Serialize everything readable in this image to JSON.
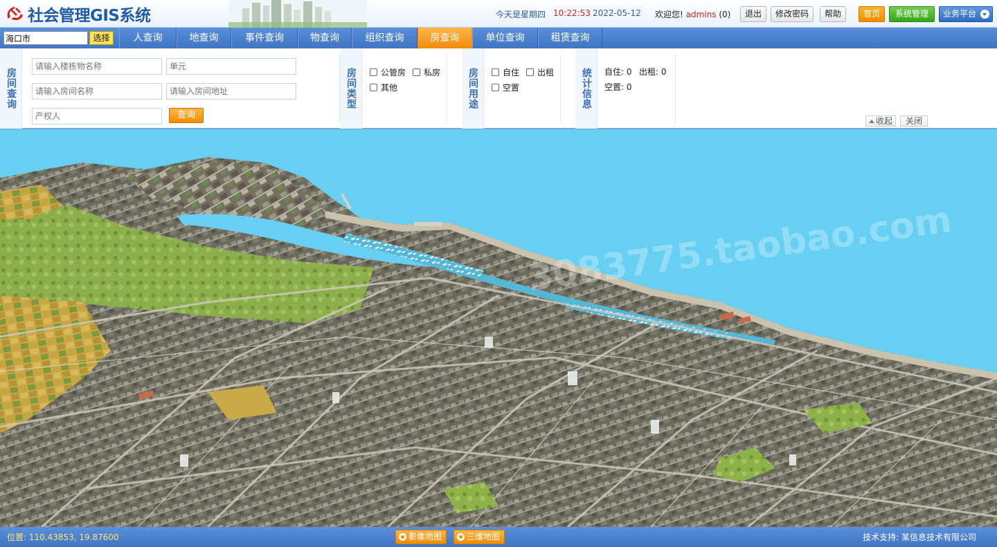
{
  "header": {
    "title": "社会管理GIS系统",
    "date_label": "今天是星期四",
    "clock": "10:22:53",
    "date": "2022-05-12",
    "welcome": "欢迎您!",
    "user": "admins",
    "user_count": "(0)",
    "logout": "退出",
    "change_password": "修改密码",
    "help": "帮助",
    "home": "首页",
    "system_admin": "系统管理",
    "business_platform": "业务平台"
  },
  "nav": {
    "city_value": "海口市",
    "city_button": "选择",
    "tabs": [
      {
        "label": "人查询",
        "active": false
      },
      {
        "label": "地查询",
        "active": false
      },
      {
        "label": "事件查询",
        "active": false
      },
      {
        "label": "物查询",
        "active": false
      },
      {
        "label": "组织查询",
        "active": false
      },
      {
        "label": "房查询",
        "active": true
      },
      {
        "label": "单位查询",
        "active": false
      },
      {
        "label": "租赁查询",
        "active": false
      }
    ]
  },
  "query": {
    "section_room_query": "房间查询",
    "building_placeholder": "请输入楼栋物名称",
    "unit_placeholder": "单元",
    "room_name_placeholder": "请输入房间名称",
    "room_address_placeholder": "请输入房间地址",
    "owner_placeholder": "产权人",
    "query_button": "查询",
    "section_room_type": "房间类型",
    "types": [
      "公管房",
      "私房",
      "其他"
    ],
    "section_room_use": "房间用途",
    "uses": [
      "自住",
      "出租",
      "空置"
    ],
    "section_stats": "统计信息",
    "stats": {
      "self_live": "自住: 0",
      "rent": "出租: 0",
      "vacant": "空置: 0"
    },
    "collapse": "收起",
    "close": "关闭"
  },
  "map": {
    "watermark": "3083775.taobao.com"
  },
  "footer": {
    "coords": "位置: 110.43853, 19.87600",
    "image_map": "影像地图",
    "map_3d": "三维地图",
    "support": "技术支持: 某信息技术有限公司"
  },
  "colors": {
    "brand_blue": "#3f75c4",
    "accent_orange": "#f28b0c",
    "sea": "#67d0f2",
    "alert_red": "#d42020"
  }
}
